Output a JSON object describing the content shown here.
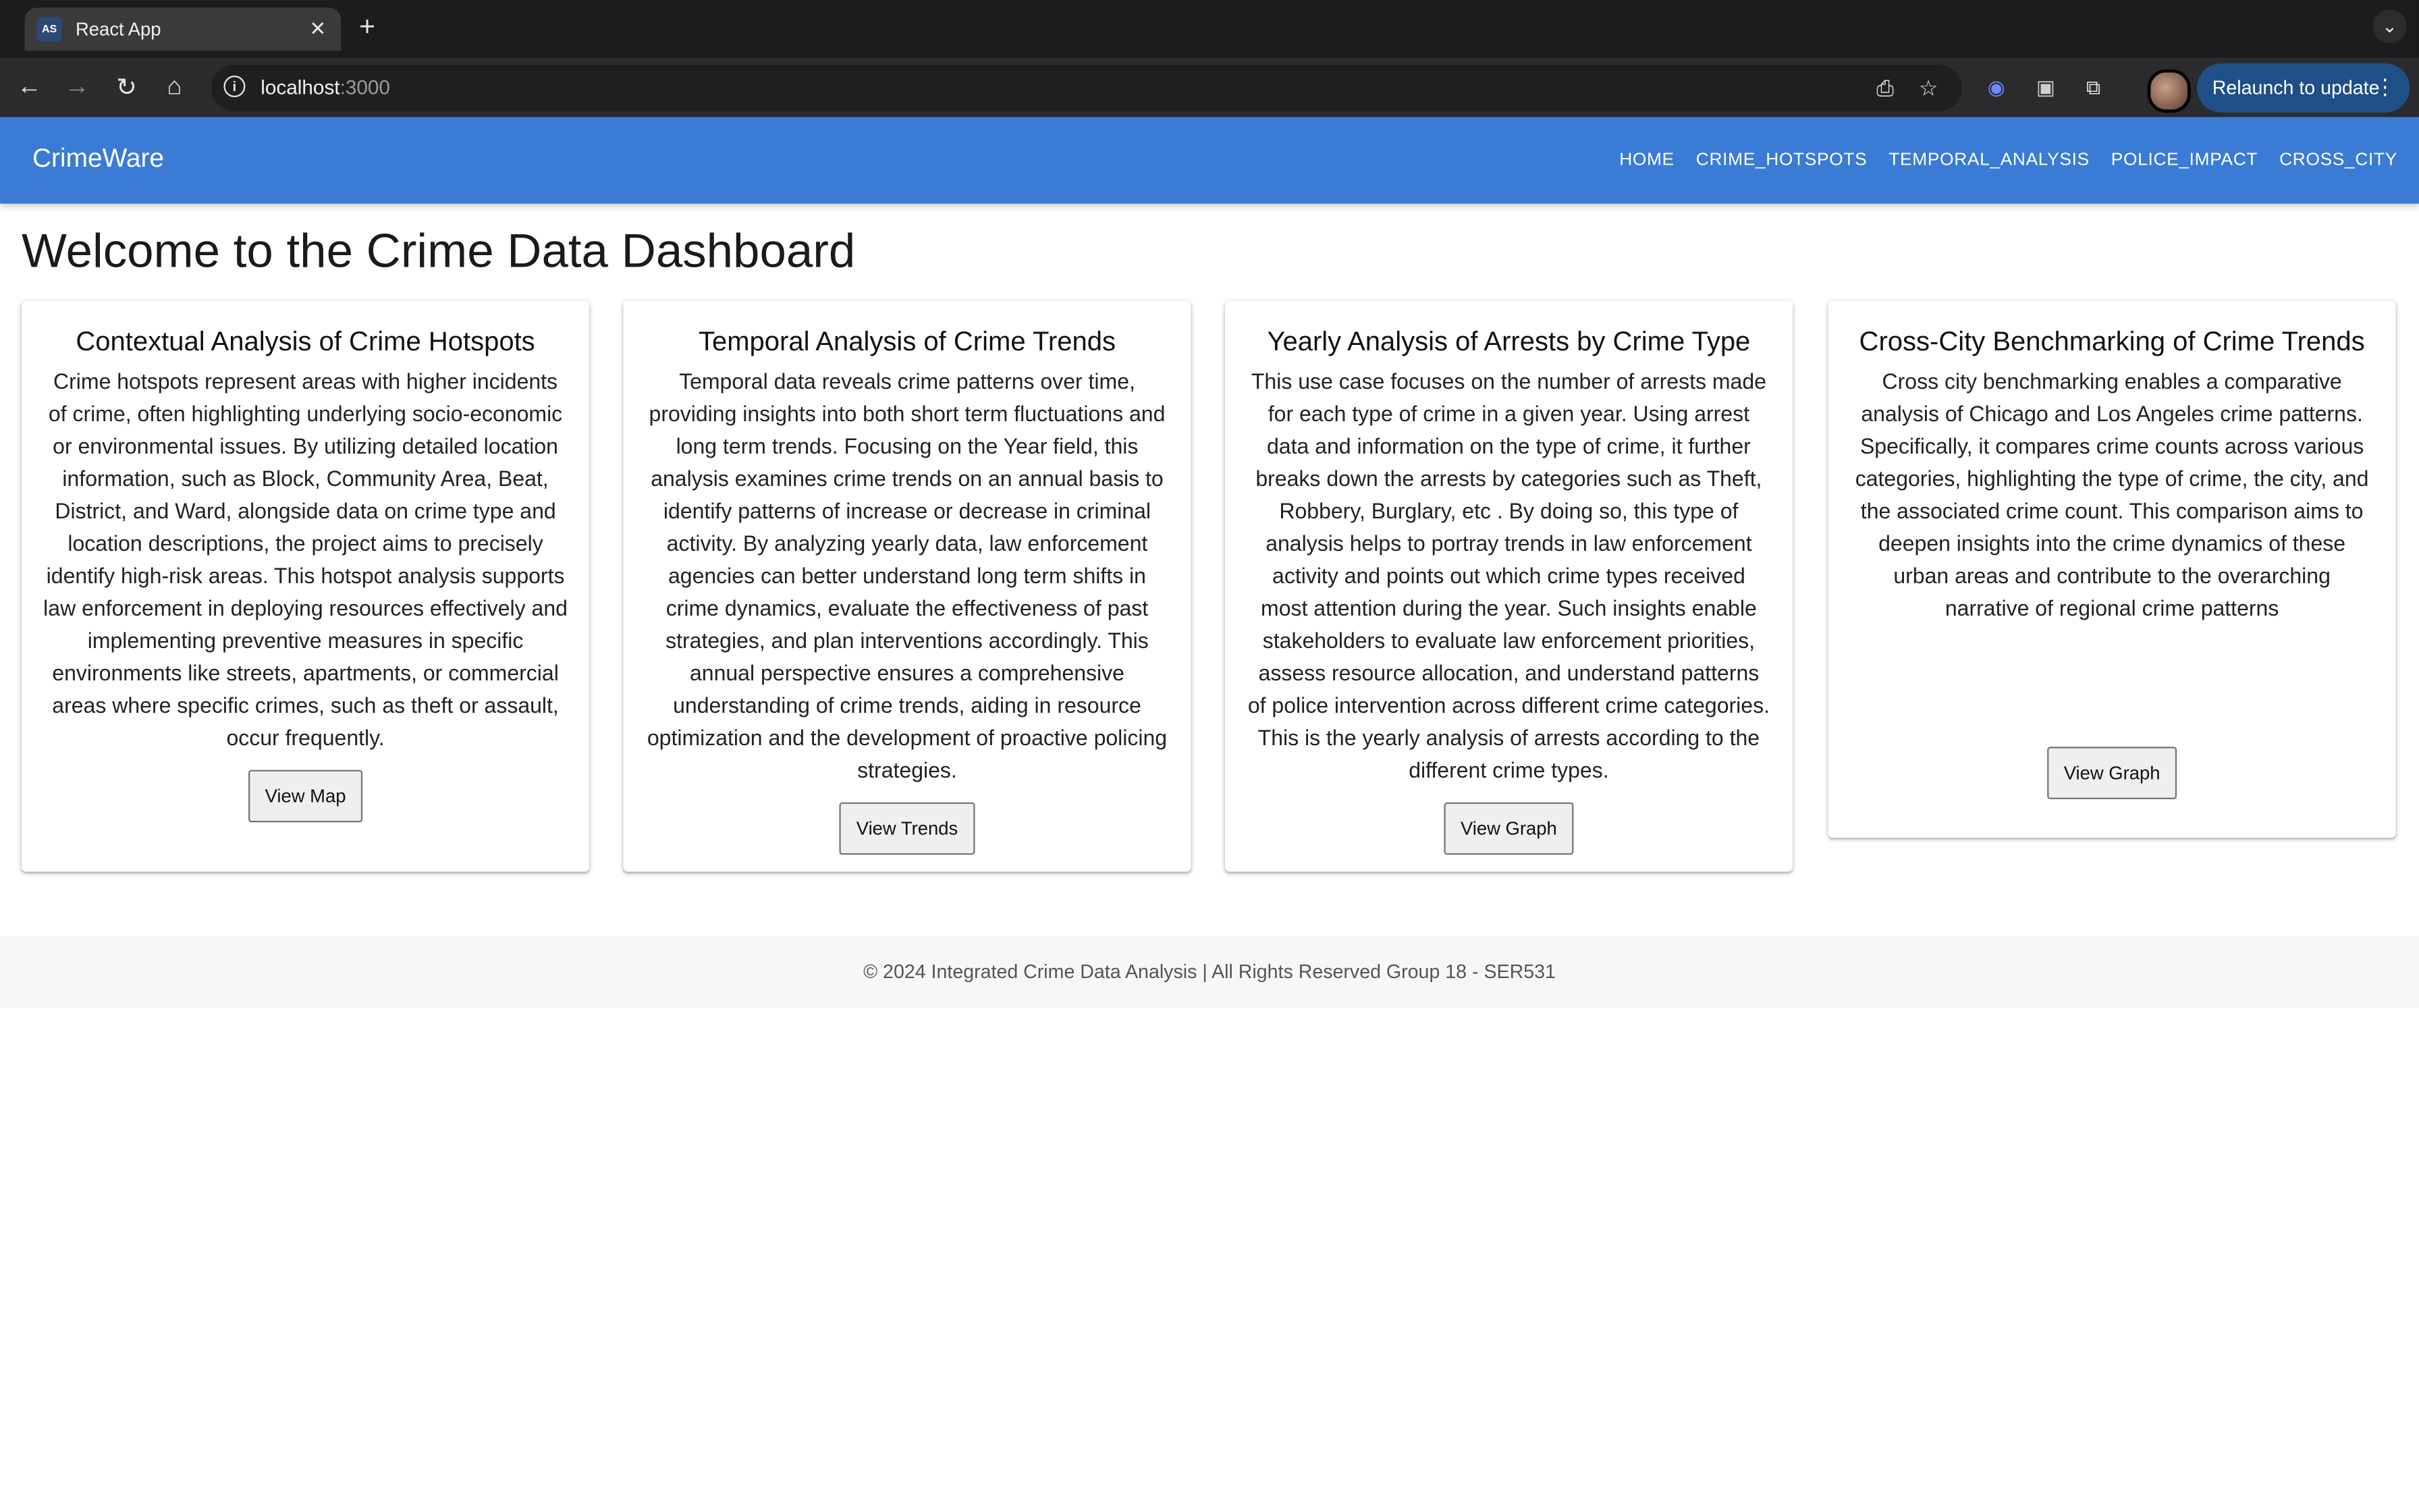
{
  "browser": {
    "tab_title": "React App",
    "tab_favicon_text": "AS",
    "url_host": "localhost",
    "url_port": ":3000",
    "relaunch_label": "Relaunch to update"
  },
  "app": {
    "brand": "CrimeWare",
    "nav": [
      "HOME",
      "CRIME_HOTSPOTS",
      "TEMPORAL_ANALYSIS",
      "POLICE_IMPACT",
      "CROSS_CITY"
    ],
    "page_title": "Welcome to the Crime Data Dashboard",
    "accent_color": "#3a7bd5"
  },
  "cards": [
    {
      "title": "Contextual Analysis of Crime Hotspots",
      "body": "Crime hotspots represent areas with higher incidents of crime, often highlighting underlying socio-economic or environmental issues. By utilizing detailed location information, such as Block, Community Area, Beat, District, and Ward, alongside data on crime type and location descriptions, the project aims to precisely identify high-risk areas. This hotspot analysis supports law enforcement in deploying resources effectively and implementing preventive measures in specific environments like streets, apartments, or commercial areas where specific crimes, such as theft or assault, occur frequently.",
      "button": "View Map"
    },
    {
      "title": "Temporal Analysis of Crime Trends",
      "body": "Temporal data reveals crime patterns over time, providing insights into both short term fluctuations and long term trends. Focusing on the Year field, this analysis examines crime trends on an annual basis to identify patterns of increase or decrease in criminal activity. By analyzing yearly data, law enforcement agencies can better understand long term shifts in crime dynamics, evaluate the effectiveness of past strategies, and plan interventions accordingly. This annual perspective ensures a comprehensive understanding of crime trends, aiding in resource optimization and the development of proactive policing strategies.",
      "button": "View Trends"
    },
    {
      "title": "Yearly Analysis of Arrests by Crime Type",
      "body": "This use case focuses on the number of arrests made for each type of crime in a given year. Using arrest data and information on the type of crime, it further breaks down the arrests by categories such as Theft, Robbery, Burglary, etc . By doing so, this type of analysis helps to portray trends in law enforcement activity and points out which crime types received most attention during the year. Such insights enable stakeholders to evaluate law enforcement priorities, assess resource allocation, and understand patterns of police intervention across different crime categories. This is the yearly analysis of arrests according to the different crime types.",
      "button": "View Graph"
    },
    {
      "title": "Cross-City Benchmarking of Crime Trends",
      "body": "Cross city benchmarking enables a comparative analysis of Chicago and Los Angeles crime patterns. Specifically, it compares crime counts across various categories, highlighting the type of crime, the city, and the associated crime count. This comparison aims to deepen insights into the crime dynamics of these urban areas and contribute to the overarching narrative of regional crime patterns",
      "button": "View Graph"
    }
  ],
  "footer": "© 2024 Integrated Crime Data Analysis | All Rights Reserved Group 18 - SER531"
}
